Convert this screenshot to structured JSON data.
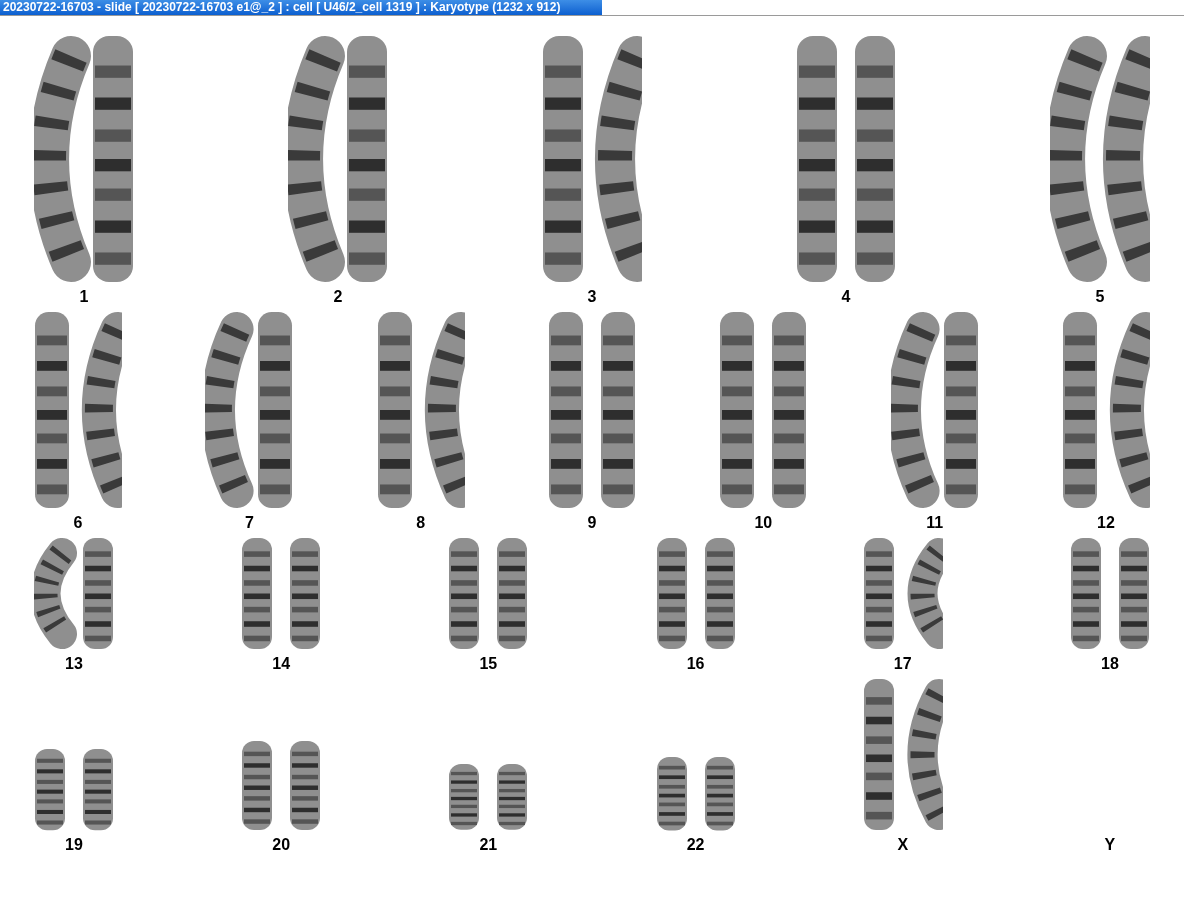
{
  "window": {
    "title": "20230722-16703 - slide [ 20230722-16703 e1@_2 ] : cell [ U46/2_cell 1319 ] : Karyotype  (1232 x 912)"
  },
  "karyotype": {
    "rows": [
      {
        "groups": [
          {
            "label": "1",
            "chromosomes": [
              {
                "kind": "bent"
              },
              {
                "kind": "straight"
              }
            ]
          },
          {
            "label": "2",
            "chromosomes": [
              {
                "kind": "bent"
              },
              {
                "kind": "straight"
              }
            ]
          },
          {
            "label": "3",
            "chromosomes": [
              {
                "kind": "straight"
              },
              {
                "kind": "bent"
              }
            ]
          },
          {
            "label": "4",
            "chromosomes": [
              {
                "kind": "straight"
              },
              {
                "kind": "straight"
              }
            ]
          },
          {
            "label": "5",
            "chromosomes": [
              {
                "kind": "bent"
              },
              {
                "kind": "bent"
              }
            ]
          }
        ]
      },
      {
        "groups": [
          {
            "label": "6",
            "chromosomes": [
              {
                "kind": "straight"
              },
              {
                "kind": "bent"
              }
            ]
          },
          {
            "label": "7",
            "chromosomes": [
              {
                "kind": "bent"
              },
              {
                "kind": "straight"
              }
            ]
          },
          {
            "label": "8",
            "chromosomes": [
              {
                "kind": "straight"
              },
              {
                "kind": "bent"
              }
            ]
          },
          {
            "label": "9",
            "chromosomes": [
              {
                "kind": "straight"
              },
              {
                "kind": "straight"
              }
            ]
          },
          {
            "label": "10",
            "chromosomes": [
              {
                "kind": "straight"
              },
              {
                "kind": "straight"
              }
            ]
          },
          {
            "label": "11",
            "chromosomes": [
              {
                "kind": "bent"
              },
              {
                "kind": "straight"
              }
            ]
          },
          {
            "label": "12",
            "chromosomes": [
              {
                "kind": "straight"
              },
              {
                "kind": "bent"
              }
            ]
          }
        ]
      },
      {
        "groups": [
          {
            "label": "13",
            "chromosomes": [
              {
                "kind": "bent"
              },
              {
                "kind": "straight"
              }
            ]
          },
          {
            "label": "14",
            "chromosomes": [
              {
                "kind": "straight"
              },
              {
                "kind": "straight"
              }
            ]
          },
          {
            "label": "15",
            "chromosomes": [
              {
                "kind": "straight"
              },
              {
                "kind": "straight"
              }
            ]
          },
          {
            "label": "16",
            "chromosomes": [
              {
                "kind": "straight"
              },
              {
                "kind": "straight"
              }
            ]
          },
          {
            "label": "17",
            "chromosomes": [
              {
                "kind": "straight"
              },
              {
                "kind": "bent"
              }
            ]
          },
          {
            "label": "18",
            "chromosomes": [
              {
                "kind": "straight"
              },
              {
                "kind": "straight"
              }
            ]
          }
        ]
      },
      {
        "groups": [
          {
            "label": "19",
            "chromosomes": [
              {
                "kind": "straight"
              },
              {
                "kind": "straight"
              }
            ]
          },
          {
            "label": "20",
            "chromosomes": [
              {
                "kind": "straight"
              },
              {
                "kind": "straight"
              }
            ]
          },
          {
            "label": "21",
            "chromosomes": [
              {
                "kind": "straight"
              },
              {
                "kind": "straight"
              }
            ]
          },
          {
            "label": "22",
            "chromosomes": [
              {
                "kind": "straight"
              },
              {
                "kind": "straight"
              }
            ]
          },
          {
            "label": "X",
            "chromosomes": [
              {
                "kind": "straight"
              },
              {
                "kind": "bent"
              }
            ]
          },
          {
            "label": "Y"
          }
        ]
      }
    ]
  }
}
